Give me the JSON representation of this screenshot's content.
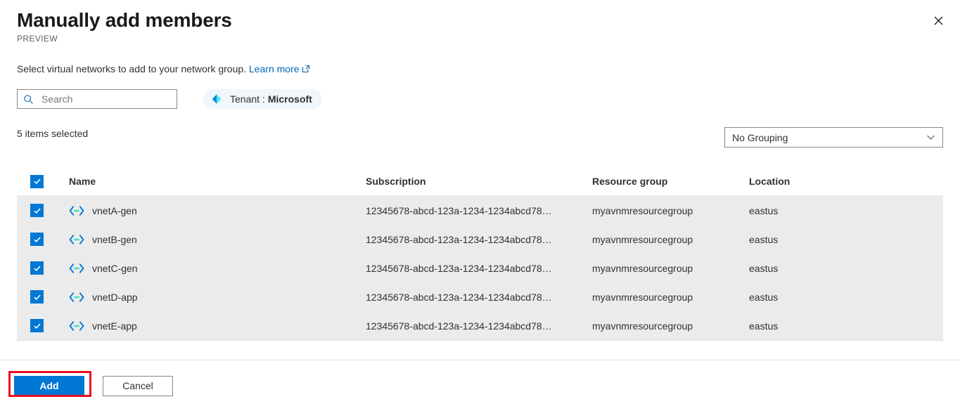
{
  "header": {
    "title": "Manually add members",
    "preview_label": "PREVIEW",
    "close_icon": "close-icon"
  },
  "description": {
    "text": "Select virtual networks to add to your network group.",
    "link_label": "Learn more",
    "link_icon": "external-link-icon"
  },
  "toolbar": {
    "search": {
      "placeholder": "Search",
      "value": "",
      "icon": "search-icon"
    },
    "tenant": {
      "label": "Tenant :",
      "value": "Microsoft",
      "icon": "azure-tenant-icon"
    }
  },
  "selection": {
    "count_label": "5 items selected"
  },
  "grouping": {
    "selected": "No Grouping",
    "icon": "chevron-down-icon",
    "options": [
      "No Grouping"
    ]
  },
  "table": {
    "columns": [
      "Name",
      "Subscription",
      "Resource group",
      "Location"
    ],
    "select_all_checked": true,
    "rows": [
      {
        "checked": true,
        "icon": "virtual-network-icon",
        "name": "vnetA-gen",
        "subscription": "12345678-abcd-123a-1234-1234abcd78…",
        "resource_group": "myavnmresourcegroup",
        "location": "eastus"
      },
      {
        "checked": true,
        "icon": "virtual-network-icon",
        "name": "vnetB-gen",
        "subscription": "12345678-abcd-123a-1234-1234abcd78…",
        "resource_group": "myavnmresourcegroup",
        "location": "eastus"
      },
      {
        "checked": true,
        "icon": "virtual-network-icon",
        "name": "vnetC-gen",
        "subscription": "12345678-abcd-123a-1234-1234abcd78…",
        "resource_group": "myavnmresourcegroup",
        "location": "eastus"
      },
      {
        "checked": true,
        "icon": "virtual-network-icon",
        "name": "vnetD-app",
        "subscription": "12345678-abcd-123a-1234-1234abcd78…",
        "resource_group": "myavnmresourcegroup",
        "location": "eastus"
      },
      {
        "checked": true,
        "icon": "virtual-network-icon",
        "name": "vnetE-app",
        "subscription": "12345678-abcd-123a-1234-1234abcd78…",
        "resource_group": "myavnmresourcegroup",
        "location": "eastus"
      }
    ]
  },
  "footer": {
    "add_label": "Add",
    "cancel_label": "Cancel"
  },
  "colors": {
    "accent_blue": "#0078d4",
    "link_blue": "#0067b8",
    "row_selected_bg": "#ebebeb",
    "tenant_pill_bg": "#eff6fc",
    "highlight_red": "#e81123"
  }
}
